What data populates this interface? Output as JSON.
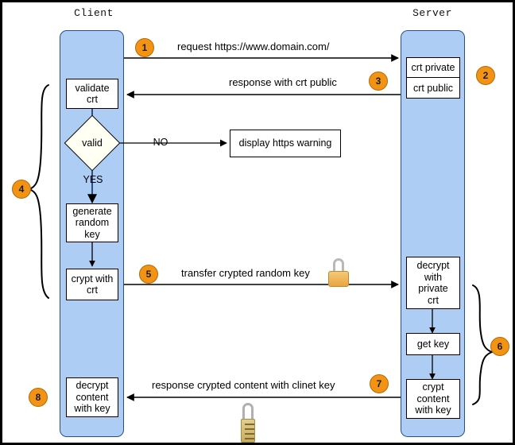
{
  "diagram": {
    "title_client": "Client",
    "title_server": "Server",
    "lanes": {
      "client": {
        "label": "Client"
      },
      "server": {
        "label": "Server"
      }
    },
    "client_nodes": {
      "validate": "validate\ncrt",
      "validate_line1": "validate",
      "validate_line2": "crt",
      "decision": "valid",
      "yes_label": "YES",
      "no_label": "NO",
      "warning": "display https warning",
      "generate_line1": "generate",
      "generate_line2": "random",
      "generate_line3": "key",
      "crypt_line1": "crypt with",
      "crypt_line2": "crt",
      "decrypt_line1": "decrypt",
      "decrypt_line2": "content",
      "decrypt_line3": "with key"
    },
    "server_nodes": {
      "crt_private": "crt private",
      "crt_public": "crt public",
      "decrypt_line1": "decrypt",
      "decrypt_line2": "with",
      "decrypt_line3": "private",
      "decrypt_line4": "crt",
      "get_key": "get key",
      "crypt_line1": "crypt",
      "crypt_line2": "content",
      "crypt_line3": "with key"
    },
    "messages": {
      "m1": "request https://www.domain.com/",
      "m3": "response with crt public",
      "m5": "transfer crypted random key",
      "m7": "response crypted content with clinet key"
    },
    "steps": {
      "s1": "1",
      "s2": "2",
      "s3": "3",
      "s4": "4",
      "s5": "5",
      "s6": "6",
      "s7": "7",
      "s8": "8"
    },
    "icons": {
      "lock_transfer": "padlock-icon",
      "lock_response": "combination-padlock-icon"
    },
    "colors": {
      "lifeline_fill": "#aecdf5",
      "lifeline_stroke": "#2b4f82",
      "badge_fill": "#f39313",
      "badge_stroke": "#b36a06",
      "box_fill": "#ffffff",
      "line": "#000000",
      "lock_gold": "#e8a63f"
    }
  }
}
